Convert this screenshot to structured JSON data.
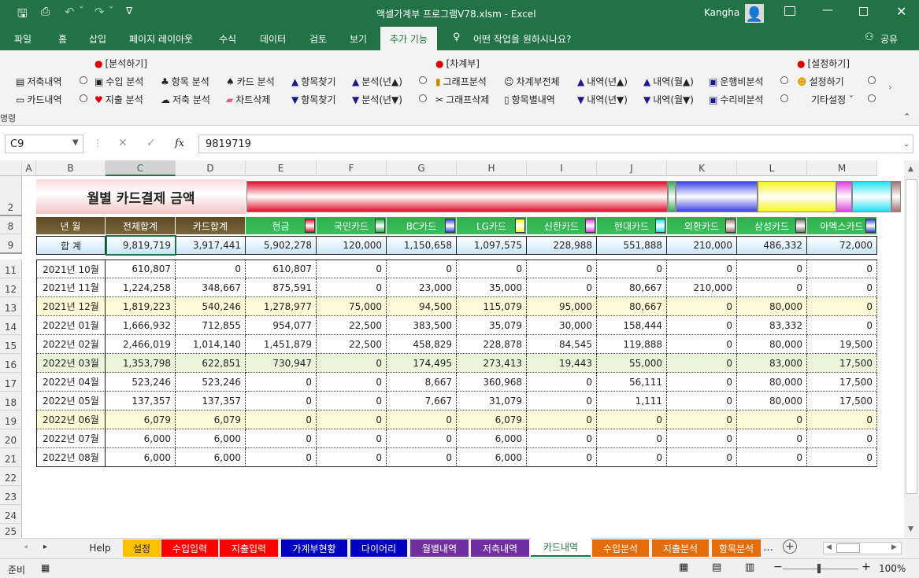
{
  "window": {
    "title": "액셀가계부 프로그램V78.xlsm  -  Excel",
    "user": "Kangha"
  },
  "ribbon_tabs": [
    "파일",
    "홈",
    "삽입",
    "페이지 레이아웃",
    "수식",
    "데이터",
    "검토",
    "보기",
    "추가 기능"
  ],
  "tell_me": "어떤 작업을 원하시나요?",
  "share": "공유",
  "ribbon": {
    "group1": "[분석하기]",
    "group2": "[차계부]",
    "group3": "[설정하기]",
    "group_footer": "명령",
    "r1": [
      "저축내역",
      "수입 분석",
      "항목 분석",
      "카드 분석",
      "항목찾기",
      "분석(년▲)",
      "그래프분석",
      "차계부전체",
      "내역(년▲)",
      "내역(월▲)",
      "운행비분석",
      "설정하기"
    ],
    "r2": [
      "카드내역",
      "지출 분석",
      "저축 분석",
      "차트삭제",
      "항목찾기",
      "분석(년▼)",
      "그래프삭제",
      "항목별내역",
      "내역(년▼)",
      "내역(월▼)",
      "수리비분석",
      "기타설정 ˇ"
    ]
  },
  "formula": {
    "namebox": "C9",
    "fx": "fx",
    "value": "9819719"
  },
  "columns": [
    "A",
    "B",
    "C",
    "D",
    "E",
    "F",
    "G",
    "H",
    "I",
    "J",
    "K",
    "L",
    "M"
  ],
  "rows": [
    "2",
    "8",
    "9",
    "11",
    "12",
    "13",
    "14",
    "15",
    "16",
    "17",
    "18",
    "19",
    "20",
    "21",
    "22",
    "23",
    "24",
    "25"
  ],
  "sheet_title": "월별 카드결제 금액",
  "colors": {
    "accent": "#217346",
    "hdr_brown": "#5c4a26",
    "hdr_green": "#2fae4e",
    "hl_yellow": "#fffbd8",
    "hl_green": "#ebf5dc"
  },
  "header": [
    "년    월",
    "전체합계",
    "카드합계",
    "현금",
    "국민카드",
    "BC카드",
    "LG카드",
    "신한카드",
    "현대카드",
    "외환카드",
    "삼성카드",
    "아멕스카드"
  ],
  "total": [
    "합    계",
    "9,819,719",
    "3,917,441",
    "5,902,278",
    "120,000",
    "1,150,658",
    "1,097,575",
    "228,988",
    "551,888",
    "210,000",
    "486,332",
    "72,000"
  ],
  "data": [
    [
      "2021년 10월",
      "610,807",
      "0",
      "610,807",
      "0",
      "0",
      "0",
      "0",
      "0",
      "0",
      "0",
      "0"
    ],
    [
      "2021년 11월",
      "1,224,258",
      "348,667",
      "875,591",
      "0",
      "23,000",
      "35,000",
      "0",
      "80,667",
      "210,000",
      "0",
      "0"
    ],
    [
      "2021년 12월",
      "1,819,223",
      "540,246",
      "1,278,977",
      "75,000",
      "94,500",
      "115,079",
      "95,000",
      "80,667",
      "0",
      "80,000",
      "0"
    ],
    [
      "2022년 01월",
      "1,666,932",
      "712,855",
      "954,077",
      "22,500",
      "383,500",
      "35,079",
      "30,000",
      "158,444",
      "0",
      "83,332",
      "0"
    ],
    [
      "2022년 02월",
      "2,466,019",
      "1,014,140",
      "1,451,879",
      "22,500",
      "458,829",
      "228,878",
      "84,545",
      "119,888",
      "0",
      "80,000",
      "19,500"
    ],
    [
      "2022년 03월",
      "1,353,798",
      "622,851",
      "730,947",
      "0",
      "174,495",
      "273,413",
      "19,443",
      "55,000",
      "0",
      "83,000",
      "17,500"
    ],
    [
      "2022년 04월",
      "523,246",
      "523,246",
      "0",
      "0",
      "8,667",
      "360,968",
      "0",
      "56,111",
      "0",
      "80,000",
      "17,500"
    ],
    [
      "2022년 05월",
      "137,357",
      "137,357",
      "0",
      "0",
      "7,667",
      "31,079",
      "0",
      "1,111",
      "0",
      "80,000",
      "17,500"
    ],
    [
      "2022년 06월",
      "6,079",
      "6,079",
      "0",
      "0",
      "0",
      "6,079",
      "0",
      "0",
      "0",
      "0",
      "0"
    ],
    [
      "2022년 07월",
      "6,000",
      "6,000",
      "0",
      "0",
      "0",
      "6,000",
      "0",
      "0",
      "0",
      "0",
      "0"
    ],
    [
      "2022년 08월",
      "6,000",
      "6,000",
      "0",
      "0",
      "0",
      "6,000",
      "0",
      "0",
      "0",
      "0",
      "0"
    ]
  ],
  "sheet_tabs": [
    "Help",
    "설정",
    "수입입력",
    "지출입력",
    "가계부현황",
    "다이어리",
    "월별내역",
    "저축내역",
    "카드내역",
    "수입분석",
    "지출분석",
    "항목분석"
  ],
  "status": {
    "ready": "준비",
    "zoom": "100%"
  }
}
